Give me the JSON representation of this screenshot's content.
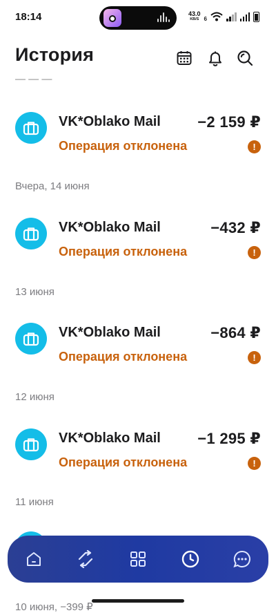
{
  "status_bar": {
    "time": "18:14",
    "net_speed": "43.0",
    "net_unit": "KB/S",
    "net_type": "6"
  },
  "header": {
    "title": "История",
    "icons": [
      "calendar-icon",
      "bell-icon",
      "search-icon"
    ]
  },
  "list": {
    "peek_text": "— — —",
    "transactions": [
      {
        "date": "",
        "merchant": "VK*Oblako Mail",
        "amount": "−2 159 ₽",
        "status": "Операция отклонена"
      },
      {
        "date": "Вчера, 14 июня",
        "merchant": "VK*Oblako Mail",
        "amount": "−432 ₽",
        "status": "Операция отклонена"
      },
      {
        "date": "13 июня",
        "merchant": "VK*Oblako Mail",
        "amount": "−864 ₽",
        "status": "Операция отклонена"
      },
      {
        "date": "12 июня",
        "merchant": "VK*Oblako Mail",
        "amount": "−1 295 ₽",
        "status": "Операция отклонена"
      }
    ],
    "next_date": "11 июня",
    "bottom_peek": "10 июня, −399 ₽"
  },
  "nav": {
    "items": [
      "home-icon",
      "transfer-icon",
      "services-icon",
      "history-icon",
      "chat-icon"
    ],
    "active": "history-icon"
  },
  "colors": {
    "accent_blue": "#1f3aa2",
    "logo_cyan": "#14bde8",
    "declined_orange": "#c8620d"
  }
}
